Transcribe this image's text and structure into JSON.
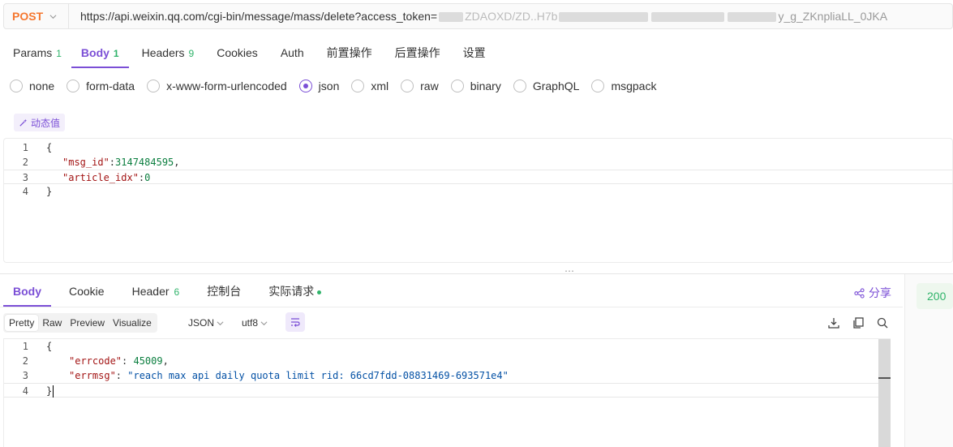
{
  "request": {
    "method": "POST",
    "url_visible_start": "https://api.weixin.qq.com/cgi-bin/message/mass/delete?access_token=",
    "url_visible_fragment_1": "JO_",
    "url_visible_fragment_2": "ZDAOXD/ZD..H7b",
    "url_visible_fragment_3": "y_g_ZKnpliaLL_0JKA"
  },
  "request_tabs": [
    {
      "label": "Params",
      "count": "1"
    },
    {
      "label": "Body",
      "count": "1"
    },
    {
      "label": "Headers",
      "count": "9"
    },
    {
      "label": "Cookies",
      "count": ""
    },
    {
      "label": "Auth",
      "count": ""
    },
    {
      "label": "前置操作",
      "count": ""
    },
    {
      "label": "后置操作",
      "count": ""
    },
    {
      "label": "设置",
      "count": ""
    }
  ],
  "active_request_tab": "Body",
  "body_types": [
    "none",
    "form-data",
    "x-www-form-urlencoded",
    "json",
    "xml",
    "raw",
    "binary",
    "GraphQL",
    "msgpack"
  ],
  "selected_body_type": "json",
  "dynamic_value_label": "动态值",
  "request_body_lines": [
    {
      "n": "1",
      "text": "{"
    },
    {
      "n": "2",
      "key": "\"msg_id\"",
      "sep": ":",
      "value": "3147484595",
      "tail": ","
    },
    {
      "n": "3",
      "key": "\"article_idx\"",
      "sep": ":",
      "value": "0",
      "tail": ""
    },
    {
      "n": "4",
      "text": "}"
    }
  ],
  "response_tabs": [
    {
      "label": "Body",
      "count": ""
    },
    {
      "label": "Cookie",
      "count": ""
    },
    {
      "label": "Header",
      "count": "6"
    },
    {
      "label": "控制台",
      "count": ""
    },
    {
      "label": "实际请求",
      "count": ""
    }
  ],
  "share_label": "分享",
  "status_code": "200",
  "format_tabs": [
    "Pretty",
    "Raw",
    "Preview",
    "Visualize"
  ],
  "active_format": "Pretty",
  "format_select": "JSON",
  "encoding_select": "utf8",
  "response_body_lines": [
    {
      "n": "1",
      "text": "{"
    },
    {
      "n": "2",
      "key": "\"errcode\"",
      "sep": ": ",
      "value": "45009",
      "tail": ","
    },
    {
      "n": "3",
      "key": "\"errmsg\"",
      "sep": ": ",
      "value": "\"reach max api daily quota limit rid: 66cd7fdd-08831469-693571e4\"",
      "tail": ""
    },
    {
      "n": "4",
      "text": "}"
    }
  ],
  "colors": {
    "accent": "#7b4fd6",
    "method": "#f5772f",
    "count": "#2fb36a"
  }
}
